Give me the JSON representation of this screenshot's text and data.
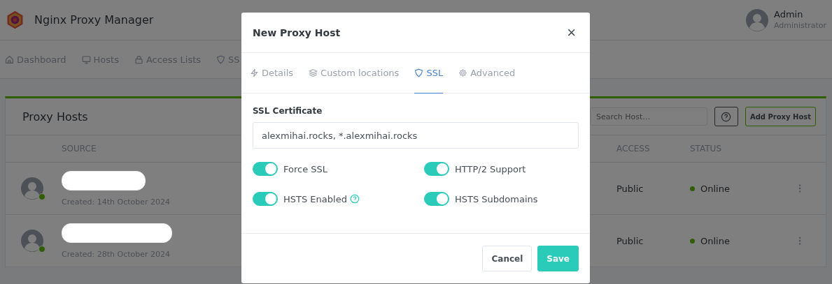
{
  "app": {
    "title": "Nginx Proxy Manager"
  },
  "user": {
    "name": "Admin",
    "role": "Administrator"
  },
  "nav": [
    {
      "label": "Dashboard",
      "selected": false
    },
    {
      "label": "Hosts",
      "selected": false
    },
    {
      "label": "Access Lists",
      "selected": false
    },
    {
      "label": "SS",
      "selected": false
    }
  ],
  "card": {
    "title": "Proxy Hosts",
    "search": {
      "placeholder": "Search Host…"
    },
    "add_button": "Add Proxy Host",
    "columns": [
      "SOURCE",
      "ACCESS",
      "STATUS"
    ],
    "rows": [
      {
        "created": "Created: 14th October 2024",
        "access": "Public",
        "status": "Online",
        "online": true
      },
      {
        "created": "Created: 28th October 2024",
        "access": "Public",
        "status": "Online",
        "online": true
      }
    ]
  },
  "modal": {
    "title": "New Proxy Host",
    "close": "×",
    "tabs": [
      {
        "label": "Details",
        "selected": false
      },
      {
        "label": "Custom locations",
        "selected": false
      },
      {
        "label": "SSL",
        "selected": true
      },
      {
        "label": "Advanced",
        "selected": false
      }
    ],
    "certificate": {
      "label": "SSL Certificate",
      "value": "alexmihai.rocks, *.alexmihai.rocks"
    },
    "toggles": [
      {
        "label": "Force SSL",
        "on": true,
        "help": false
      },
      {
        "label": "HTTP/2 Support",
        "on": true,
        "help": false
      },
      {
        "label": "HSTS Enabled",
        "on": true,
        "help": true
      },
      {
        "label": "HSTS Subdomains",
        "on": true,
        "help": false
      }
    ],
    "buttons": [
      {
        "label": "Cancel",
        "kind": "secondary"
      },
      {
        "label": "Save",
        "kind": "primary"
      }
    ]
  }
}
